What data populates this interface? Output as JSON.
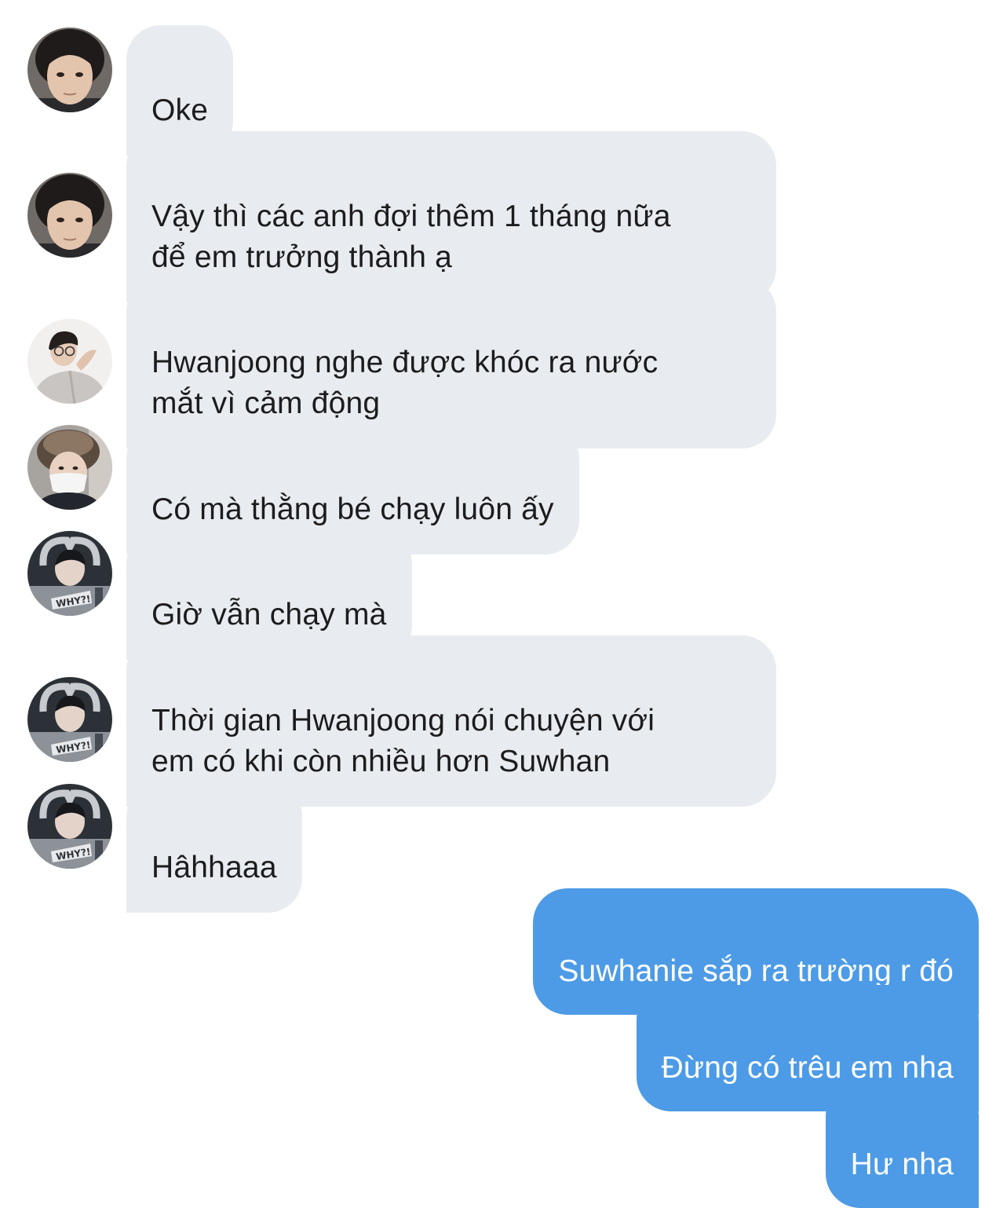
{
  "conversation": {
    "messages": [
      {
        "sender": "incoming",
        "avatar": "child-portrait-avatar",
        "text": "Oke"
      },
      {
        "sender": "incoming",
        "avatar": "child-portrait-avatar",
        "text": "Vậy thì các anh đợi thêm 1 tháng nữa\nđể em trưởng thành ạ"
      },
      {
        "sender": "incoming",
        "avatar": "glasses-hoodie-avatar",
        "text": "Hwanjoong nghe được khóc ra nước\nmắt vì cảm động"
      },
      {
        "sender": "incoming",
        "avatar": "fur-hat-mask-avatar",
        "text": "Có mà thằng bé chạy luôn ấy"
      },
      {
        "sender": "incoming",
        "avatar": "heart-pose-avatar",
        "text": "Giờ vẫn chạy mà"
      },
      {
        "sender": "incoming",
        "avatar": "heart-pose-avatar",
        "text": "Thời gian Hwanjoong nói chuyện với\nem có khi còn nhiều hơn Suwhan"
      },
      {
        "sender": "incoming",
        "avatar": "heart-pose-avatar",
        "text": "Hâhhaaa"
      },
      {
        "sender": "outgoing",
        "text": "Suwhanie sắp ra trường r đó"
      },
      {
        "sender": "outgoing",
        "text": "Đừng có trêu em nha"
      },
      {
        "sender": "outgoing",
        "text": "Hư nha"
      }
    ]
  },
  "colors": {
    "incoming_bubble": "#e8ebef",
    "incoming_text": "#1c1c1e",
    "outgoing_bubble": "#4d9be6",
    "outgoing_text": "#ffffff",
    "background": "#ffffff"
  }
}
